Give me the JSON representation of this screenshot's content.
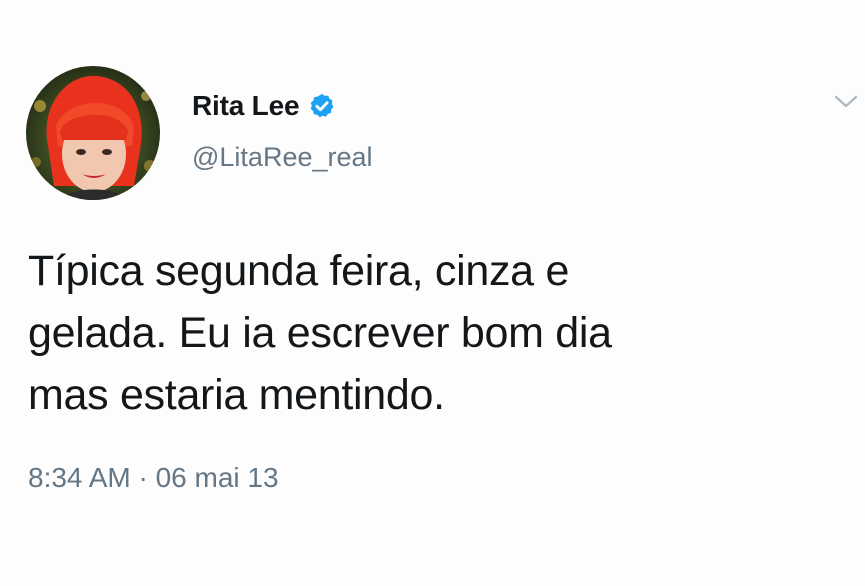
{
  "tweet": {
    "author": {
      "display_name": "Rita Lee",
      "handle": "@LitaRee_real",
      "verified": true,
      "avatar_icon": "profile-avatar"
    },
    "text": "Típica segunda feira, cinza e\ngelada. Eu ia escrever bom dia\nmas estaria mentindo.",
    "timestamp": "8:34 AM · 06 mai 13",
    "menu_icon": "chevron-down-icon"
  },
  "colors": {
    "verified_blue": "#1da1f2",
    "secondary_text": "#657786",
    "primary_text": "#14171a",
    "avatar_hair": "#e8321e"
  }
}
